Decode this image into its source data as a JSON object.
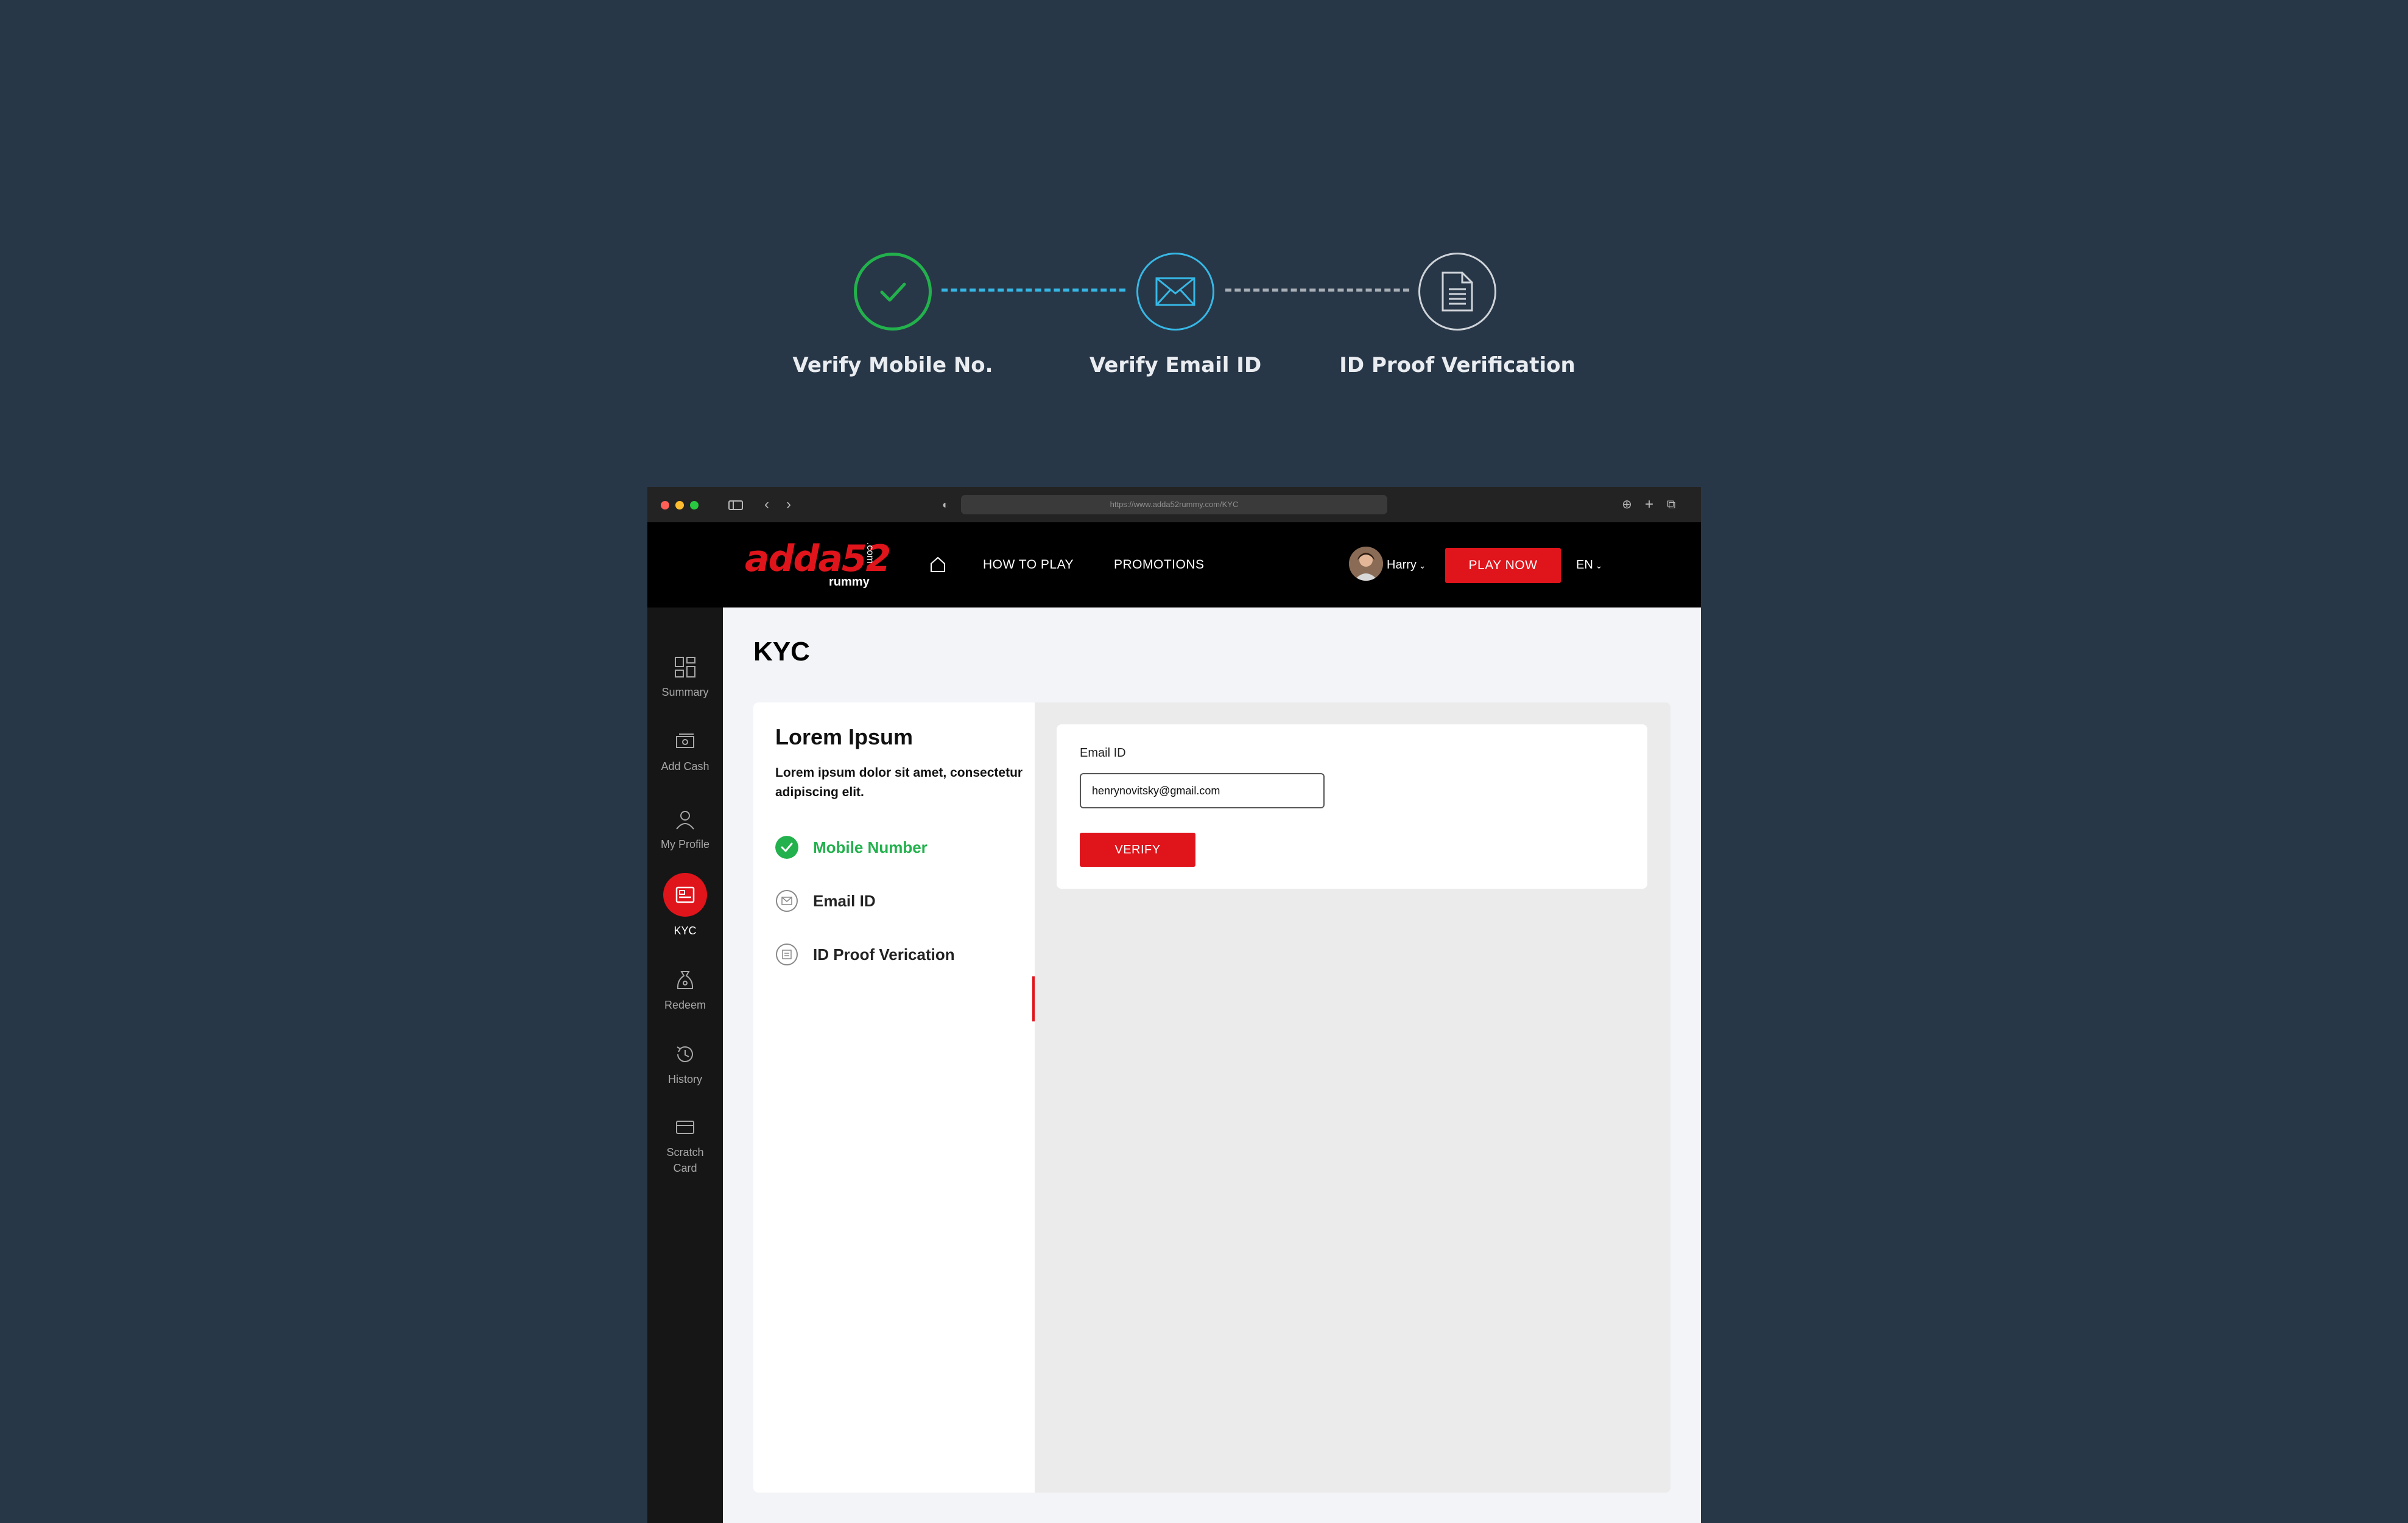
{
  "stepper": {
    "steps": [
      {
        "label": "Verify Mobile No.",
        "state": "done",
        "color": "#22b14c",
        "icon": "check-icon"
      },
      {
        "label": "Verify Email ID",
        "state": "current",
        "color": "#36b8e6",
        "icon": "mail-icon"
      },
      {
        "label": "ID Proof Verification",
        "state": "pending",
        "color": "#cfd4da",
        "icon": "document-icon"
      }
    ]
  },
  "browser": {
    "url": "https://www.adda52rummy.com/KYC"
  },
  "topnav": {
    "logo_text": "adda52",
    "logo_sub": "rummy",
    "logo_com": ".com",
    "links": [
      "HOW TO PLAY",
      "PROMOTIONS"
    ],
    "user_name": "Harry",
    "play_label": "PLAY NOW",
    "lang": "EN"
  },
  "sidebar": {
    "items": [
      {
        "label": "Summary",
        "icon": "grid-icon"
      },
      {
        "label": "Add Cash",
        "icon": "cash-icon"
      },
      {
        "label": "My Profile",
        "icon": "user-icon"
      },
      {
        "label": "KYC",
        "icon": "id-card-icon",
        "active": true
      },
      {
        "label": "Redeem",
        "icon": "money-bag-icon"
      },
      {
        "label": "History",
        "icon": "history-icon"
      },
      {
        "label": "Scratch Card",
        "icon": "card-icon"
      }
    ]
  },
  "page": {
    "title": "KYC",
    "panel_title": "Lorem Ipsum",
    "panel_desc": "Lorem ipsum dolor sit amet, consectetur adipiscing elit.",
    "steps": [
      {
        "label": "Mobile Number",
        "state": "done"
      },
      {
        "label": "Email ID",
        "state": "active"
      },
      {
        "label": "ID Proof Verication",
        "state": "pending"
      }
    ],
    "form": {
      "label": "Email ID",
      "value": "henrynovitsky@gmail.com",
      "button": "VERIFY"
    }
  },
  "colors": {
    "background": "#283747",
    "brand_red": "#e0141b",
    "success_green": "#22b14c",
    "info_blue": "#36b8e6"
  }
}
